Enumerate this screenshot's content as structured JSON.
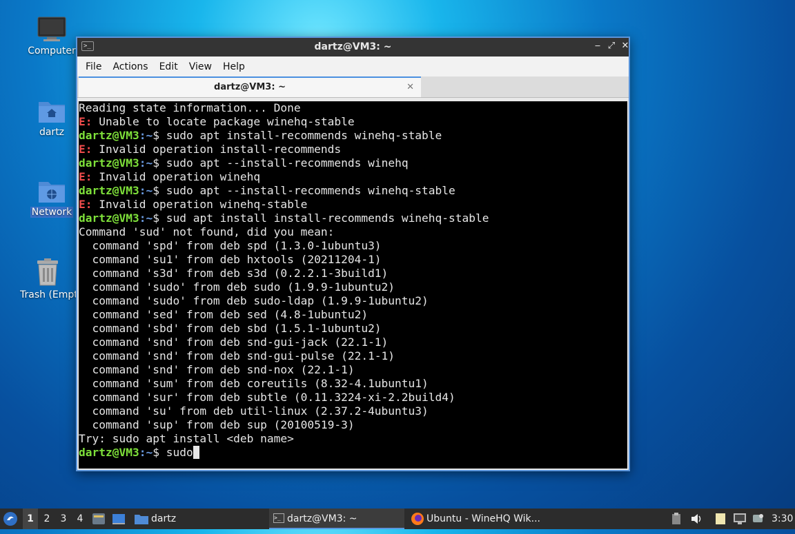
{
  "desktop": {
    "icons": [
      {
        "label": "Computer",
        "icon": "computer-icon"
      },
      {
        "label": "dartz",
        "icon": "home-folder-icon"
      },
      {
        "label": "Network",
        "icon": "network-icon"
      },
      {
        "label": "Trash (Empty)",
        "icon": "trash-icon"
      }
    ]
  },
  "window": {
    "title": "dartz@VM3: ~",
    "controls": {
      "minimize": "‒",
      "maximize": "⤢",
      "close": "✕"
    },
    "menu": [
      "File",
      "Actions",
      "Edit",
      "View",
      "Help"
    ],
    "tab": {
      "label": "dartz@VM3: ~",
      "close": "✕"
    }
  },
  "terminal": {
    "prompt_user": "dartz@VM3",
    "prompt_path": ":~",
    "prompt_symbol": "$ ",
    "error_prefix": "E:",
    "lines": [
      {
        "type": "text",
        "text": "Reading state information... Done"
      },
      {
        "type": "error",
        "text": " Unable to locate package winehq-stable"
      },
      {
        "type": "prompt",
        "text": "sudo apt install-recommends winehq-stable"
      },
      {
        "type": "error",
        "text": " Invalid operation install-recommends"
      },
      {
        "type": "prompt",
        "text": "sudo apt --install-recommends winehq"
      },
      {
        "type": "error",
        "text": " Invalid operation winehq"
      },
      {
        "type": "prompt",
        "text": "sudo apt --install-recommends winehq-stable"
      },
      {
        "type": "error",
        "text": " Invalid operation winehq-stable"
      },
      {
        "type": "prompt",
        "text": "sud apt install install-recommends winehq-stable"
      },
      {
        "type": "text",
        "text": "Command 'sud' not found, did you mean:"
      },
      {
        "type": "text",
        "text": "  command 'spd' from deb spd (1.3.0-1ubuntu3)"
      },
      {
        "type": "text",
        "text": "  command 'su1' from deb hxtools (20211204-1)"
      },
      {
        "type": "text",
        "text": "  command 's3d' from deb s3d (0.2.2.1-3build1)"
      },
      {
        "type": "text",
        "text": "  command 'sudo' from deb sudo (1.9.9-1ubuntu2)"
      },
      {
        "type": "text",
        "text": "  command 'sudo' from deb sudo-ldap (1.9.9-1ubuntu2)"
      },
      {
        "type": "text",
        "text": "  command 'sed' from deb sed (4.8-1ubuntu2)"
      },
      {
        "type": "text",
        "text": "  command 'sbd' from deb sbd (1.5.1-1ubuntu2)"
      },
      {
        "type": "text",
        "text": "  command 'snd' from deb snd-gui-jack (22.1-1)"
      },
      {
        "type": "text",
        "text": "  command 'snd' from deb snd-gui-pulse (22.1-1)"
      },
      {
        "type": "text",
        "text": "  command 'snd' from deb snd-nox (22.1-1)"
      },
      {
        "type": "text",
        "text": "  command 'sum' from deb coreutils (8.32-4.1ubuntu1)"
      },
      {
        "type": "text",
        "text": "  command 'sur' from deb subtle (0.11.3224-xi-2.2build4)"
      },
      {
        "type": "text",
        "text": "  command 'su' from deb util-linux (2.37.2-4ubuntu3)"
      },
      {
        "type": "text",
        "text": "  command 'sup' from deb sup (20100519-3)"
      },
      {
        "type": "text",
        "text": "Try: sudo apt install <deb name>"
      },
      {
        "type": "prompt",
        "text": "sudo",
        "cursor": true
      }
    ]
  },
  "taskbar": {
    "workspaces": [
      "1",
      "2",
      "3",
      "4"
    ],
    "active_workspace": "1",
    "folder_task": "dartz",
    "tasks": [
      {
        "label": "dartz@VM3: ~",
        "icon": "terminal-icon",
        "active": true
      },
      {
        "label": "Ubuntu - WineHQ Wik...",
        "icon": "firefox-icon",
        "active": false
      }
    ],
    "clock": "3:30"
  },
  "colors": {
    "prompt_user": "#7ee03a",
    "prompt_path": "#6a9ae0",
    "error": "#ef4b4b",
    "window_border": "#5a95dc"
  }
}
